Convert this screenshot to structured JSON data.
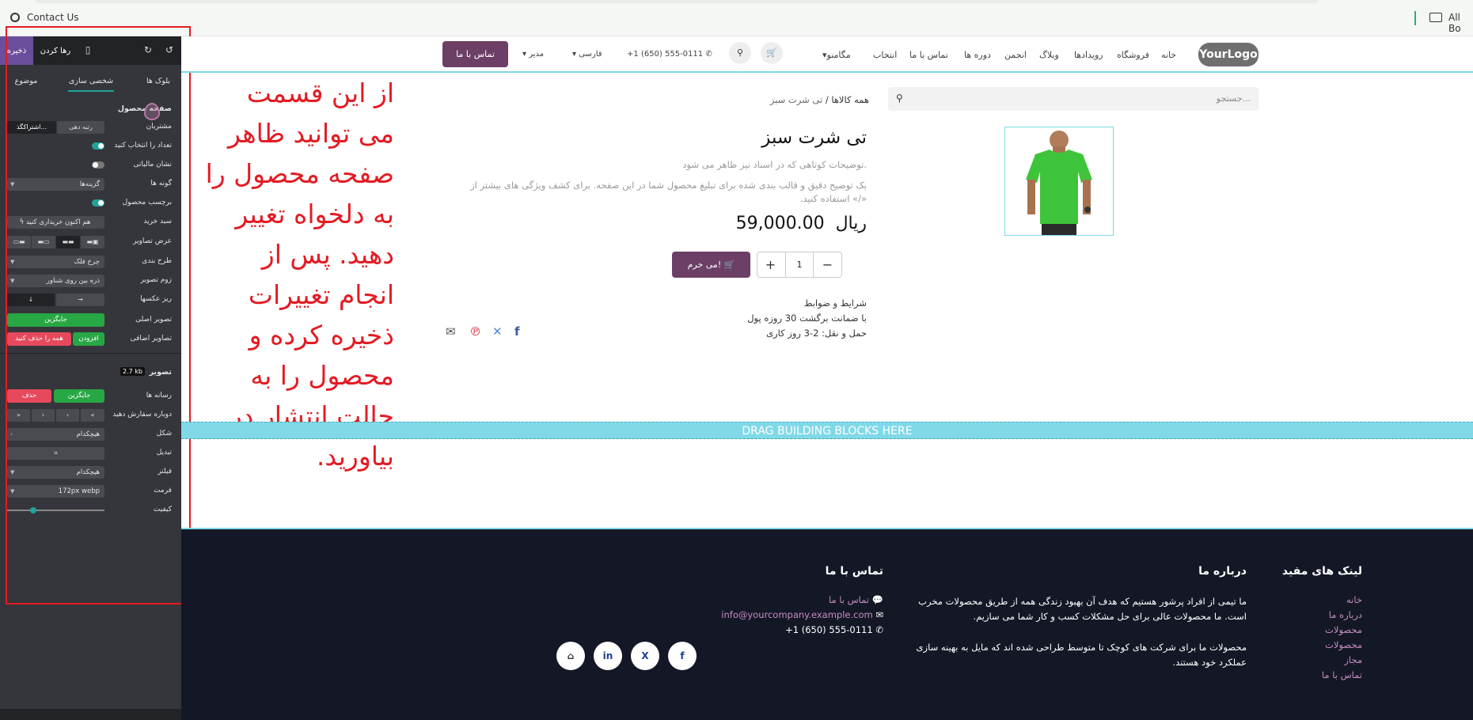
{
  "browser": {
    "bookmark_left": "Contact Us",
    "bookmark_right": "All Bo"
  },
  "editor": {
    "save": "ذخیره",
    "discard": "رها کردن",
    "tabs": [
      "بلوک ها",
      "شخصی سازی",
      "موضوع"
    ],
    "section_title": "صفحه محصول",
    "rows": {
      "customers_label": "مشتریان",
      "customers_sel1": "رتبه دهی",
      "customers_sel2": "اشتراکگذ...",
      "select_qty_label": "تعداد را انتخاب کنید",
      "tax_label": "نشان مالیاتی",
      "variants_label": "گونه ها",
      "variants_sel": "گزینه‌ها",
      "product_tag_label": "برچسب محصول",
      "cart_label": "سبد خرید",
      "cart_sel": "هم اکنون خریداری کنید",
      "image_width_label": "عرض تصاویر",
      "layout_label": "طرح بندی",
      "layout_sel": "چرخ فلک",
      "zoom_label": "زوم تصویر",
      "zoom_sel": "ذره بین روی شناور",
      "thumbs_label": "ریز عکسها",
      "main_image_label": "تصویر اصلی",
      "main_image_btn": "جایگزین",
      "extra_images_label": "تصاویر اضافی",
      "extra_add": "افزودن",
      "extra_remove_all": "همه را حذف کنید"
    },
    "image_section": {
      "title": "تصویر",
      "size": "2.7 kb",
      "media_label": "رسانه ها",
      "media_replace": "جایگزین",
      "media_delete": "حذف",
      "reorder_label": "دوباره سفارش دهید",
      "shape_label": "شکل",
      "shape_sel": "هیچکدام",
      "transform_label": "تبدیل",
      "filter_label": "فیلتر",
      "filter_sel": "هیچکدام",
      "format_label": "فرمت",
      "format_sel": "172px webp",
      "quality_label": "کیفیت",
      "quality_level": 0.27
    }
  },
  "annotation": {
    "text": "از این قسمت می توانید ظاهر صفحه محصول را به دلخواه تغییر دهید. پس از انجام تغییرات ذخیره کرده و محصول را به حالت انتشار در بیاورید.",
    "color": "#e31b23"
  },
  "site": {
    "logo": "YourLogo",
    "nav": [
      "خانه",
      "فروشگاه",
      "رویدادها",
      "وبلاگ",
      "انجمن",
      "دوره ها",
      "تماس با ما",
      "انتخاب",
      "مگامنو"
    ],
    "phone": "+1 (650) 555-0111",
    "lang": "فارسی",
    "admin": "مدیر",
    "contact_btn": "تماس با ما",
    "search_placeholder": "جستجو...",
    "breadcrumb_all": "همه کالاها",
    "breadcrumb_sep": "/",
    "breadcrumb_current": "تی شرت سبز",
    "product": {
      "title": "تی شرت سبز",
      "short_desc": "توضیحات کوتاهی که در اسناد نیز ظاهر می شود.",
      "long_desc": "یک توضیح دقیق و قالب بندی شده برای تبلیغ محصول شما در این صفحه. برای کشف ویژگی های بیشتر از «/» استفاده کنید.",
      "price": "59,000.00",
      "currency": "ریال",
      "qty": "1",
      "add_to_cart": "می خرم!",
      "terms": [
        "شرایط و ضوابط",
        "با ضمانت برگشت 30 روزه پول",
        "حمل و نقل: 2-3 روز کاری"
      ]
    },
    "drag_zone": "DRAG BUILDING BLOCKS HERE",
    "footer": {
      "links_title": "لینک های مفید",
      "links": [
        "خانه",
        "درباره ما",
        "محصولات",
        "محصولات",
        "مجاز",
        "تماس با ما"
      ],
      "about_title": "درباره ما",
      "about_p1": "ما تیمی از افراد پرشور هستیم که هدف آن بهبود زندگی همه از طریق محصولات مخرب است. ما محصولات عالی برای حل مشکلات کسب و کار شما می سازیم.",
      "about_p2": "محصولات ما برای شرکت های کوچک تا متوسط طراحی شده اند که مایل به بهینه سازی عملکرد خود هستند.",
      "contact_title": "تماس با ما",
      "contact_items": [
        "تماس با ما",
        "info@yourcompany.example.com",
        "+1 (650) 555-0111"
      ],
      "social": [
        "f",
        "X",
        "in",
        "⌂"
      ]
    }
  }
}
